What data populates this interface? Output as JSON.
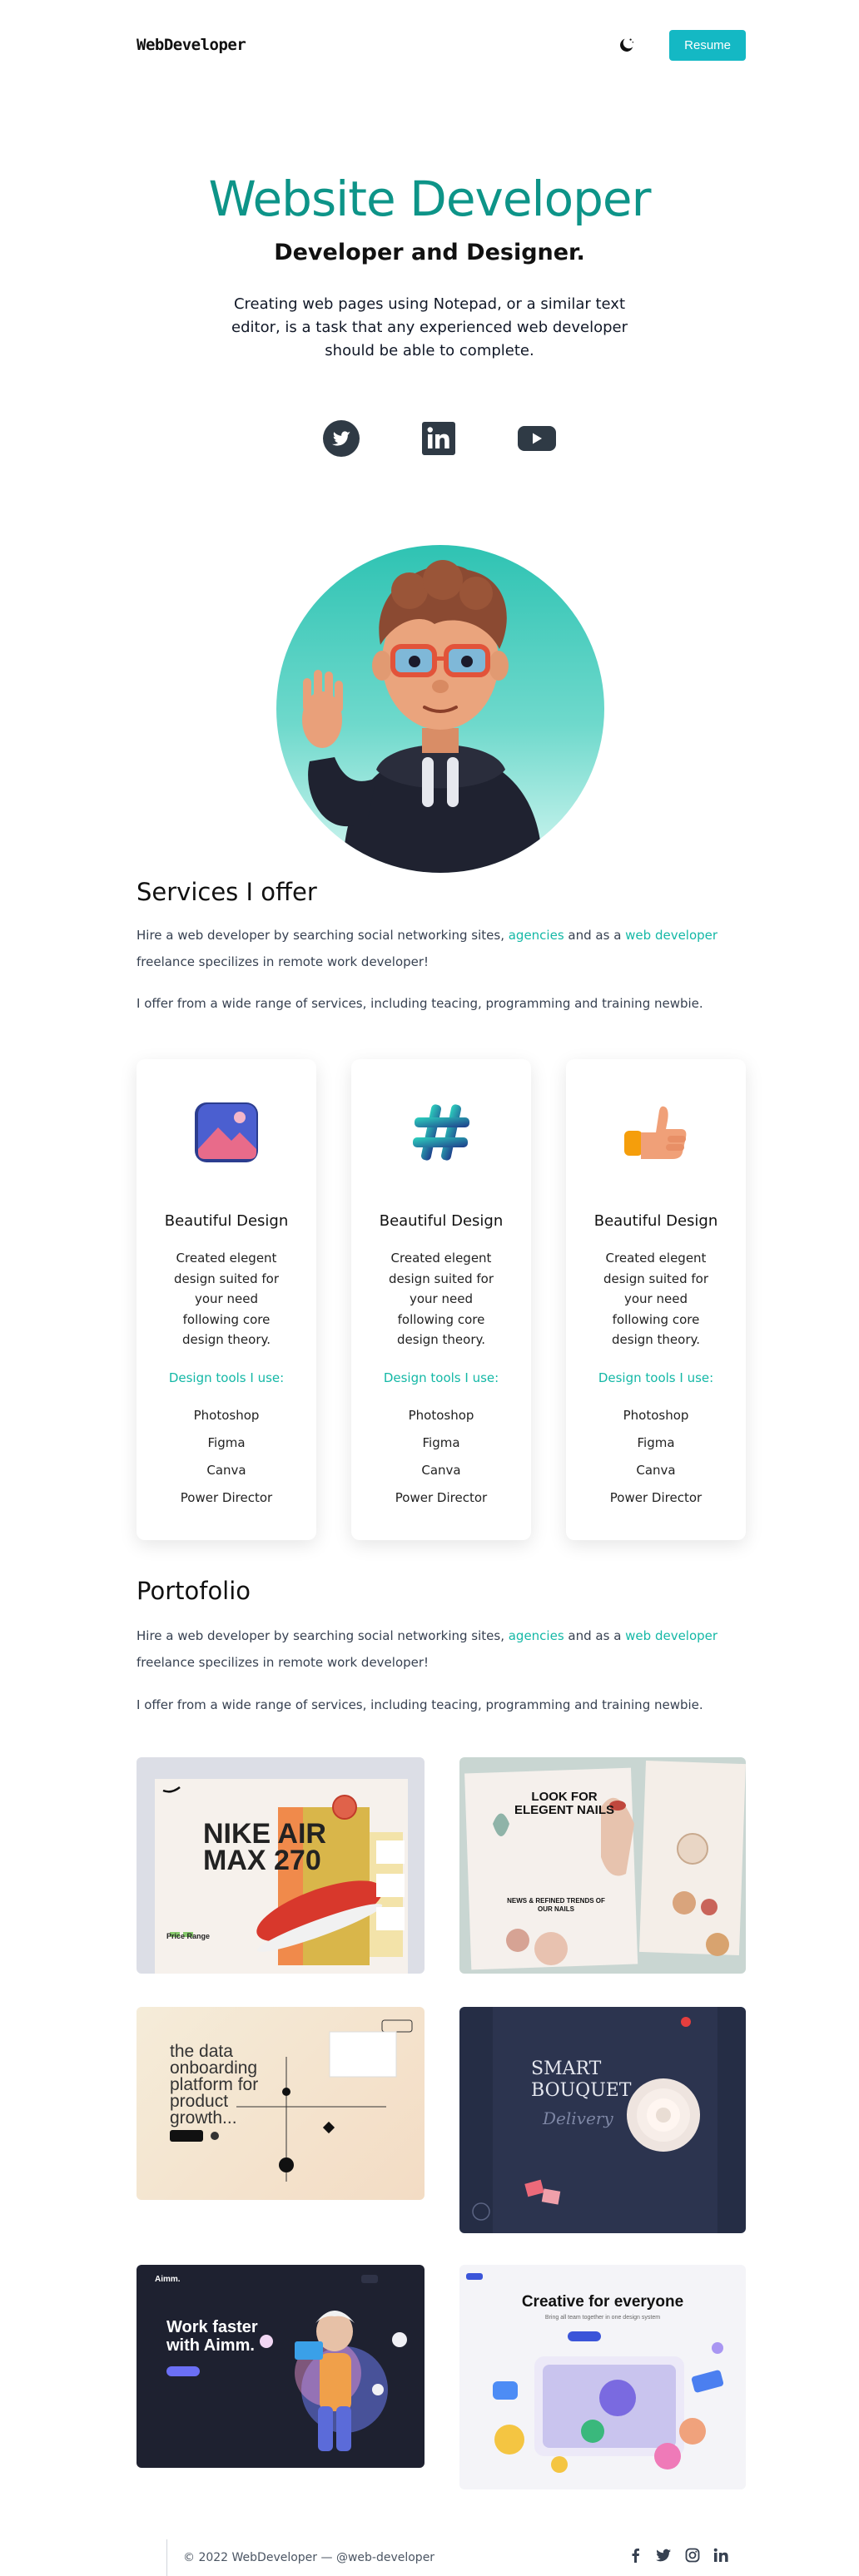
{
  "nav": {
    "logo": "WebDeveloper",
    "resume_label": "Resume"
  },
  "hero": {
    "title": "Website Developer",
    "subtitle": "Developer and Designer.",
    "description": "Creating web pages using Notepad, or a similar text editor, is a task that any experienced web developer should be able to complete."
  },
  "socials": [
    "twitter-icon",
    "linkedin-icon",
    "youtube-icon"
  ],
  "services": {
    "title": "Services I offer",
    "para1_a": "Hire a web developer by searching social networking sites, ",
    "para1_link1": "agencies",
    "para1_b": " and as a ",
    "para1_link2": "web developer",
    "para1_c": " freelance specilizes in remote work developer!",
    "para2": "I offer from a wide range of services, including teacing, programming and training newbie.",
    "cards": [
      {
        "icon": "image-icon",
        "title": "Beautiful Design",
        "desc": "Created elegent design suited for your need following core design theory.",
        "tools_label": "Design tools I use:",
        "tools": [
          "Photoshop",
          "Figma",
          "Canva",
          "Power Director"
        ]
      },
      {
        "icon": "hashtag-icon",
        "title": "Beautiful Design",
        "desc": "Created elegent design suited for your need following core design theory.",
        "tools_label": "Design tools I use:",
        "tools": [
          "Photoshop",
          "Figma",
          "Canva",
          "Power Director"
        ]
      },
      {
        "icon": "thumbs-up-icon",
        "title": "Beautiful Design",
        "desc": "Created elegent design suited for your need following core design theory.",
        "tools_label": "Design tools I use:",
        "tools": [
          "Photoshop",
          "Figma",
          "Canva",
          "Power Director"
        ]
      }
    ]
  },
  "portfolio": {
    "title": "Portofolio",
    "para1_a": "Hire a web developer by searching social networking sites, ",
    "para1_link1": "agencies",
    "para1_b": " and as a ",
    "para1_link2": "web developer",
    "para1_c": " freelance specilizes in remote work developer!",
    "para2": "I offer from a wide range of services, including teacing, programming and training newbie.",
    "items": [
      {
        "headline": "NIKE AIR MAX 270",
        "sub": "Price Range"
      },
      {
        "headline": "LOOK FOR ELEGENT NAILS",
        "sub": "NEWS & REFINED TRENDS OF OUR NAILS"
      },
      {
        "headline": "the data onboarding platform for product growth..."
      },
      {
        "headline": "SMART BOUQUET",
        "sub": "Delivery"
      },
      {
        "headline": "Work faster with Aimm.",
        "brand": "Aimm."
      },
      {
        "headline": "Creative for everyone",
        "sub": "Bring all team together in one design system"
      }
    ]
  },
  "footer": {
    "copyright": "© 2022 WebDeveloper — @web-developer"
  },
  "colors": {
    "accent": "#14b8a6",
    "button": "#14b8c4"
  }
}
